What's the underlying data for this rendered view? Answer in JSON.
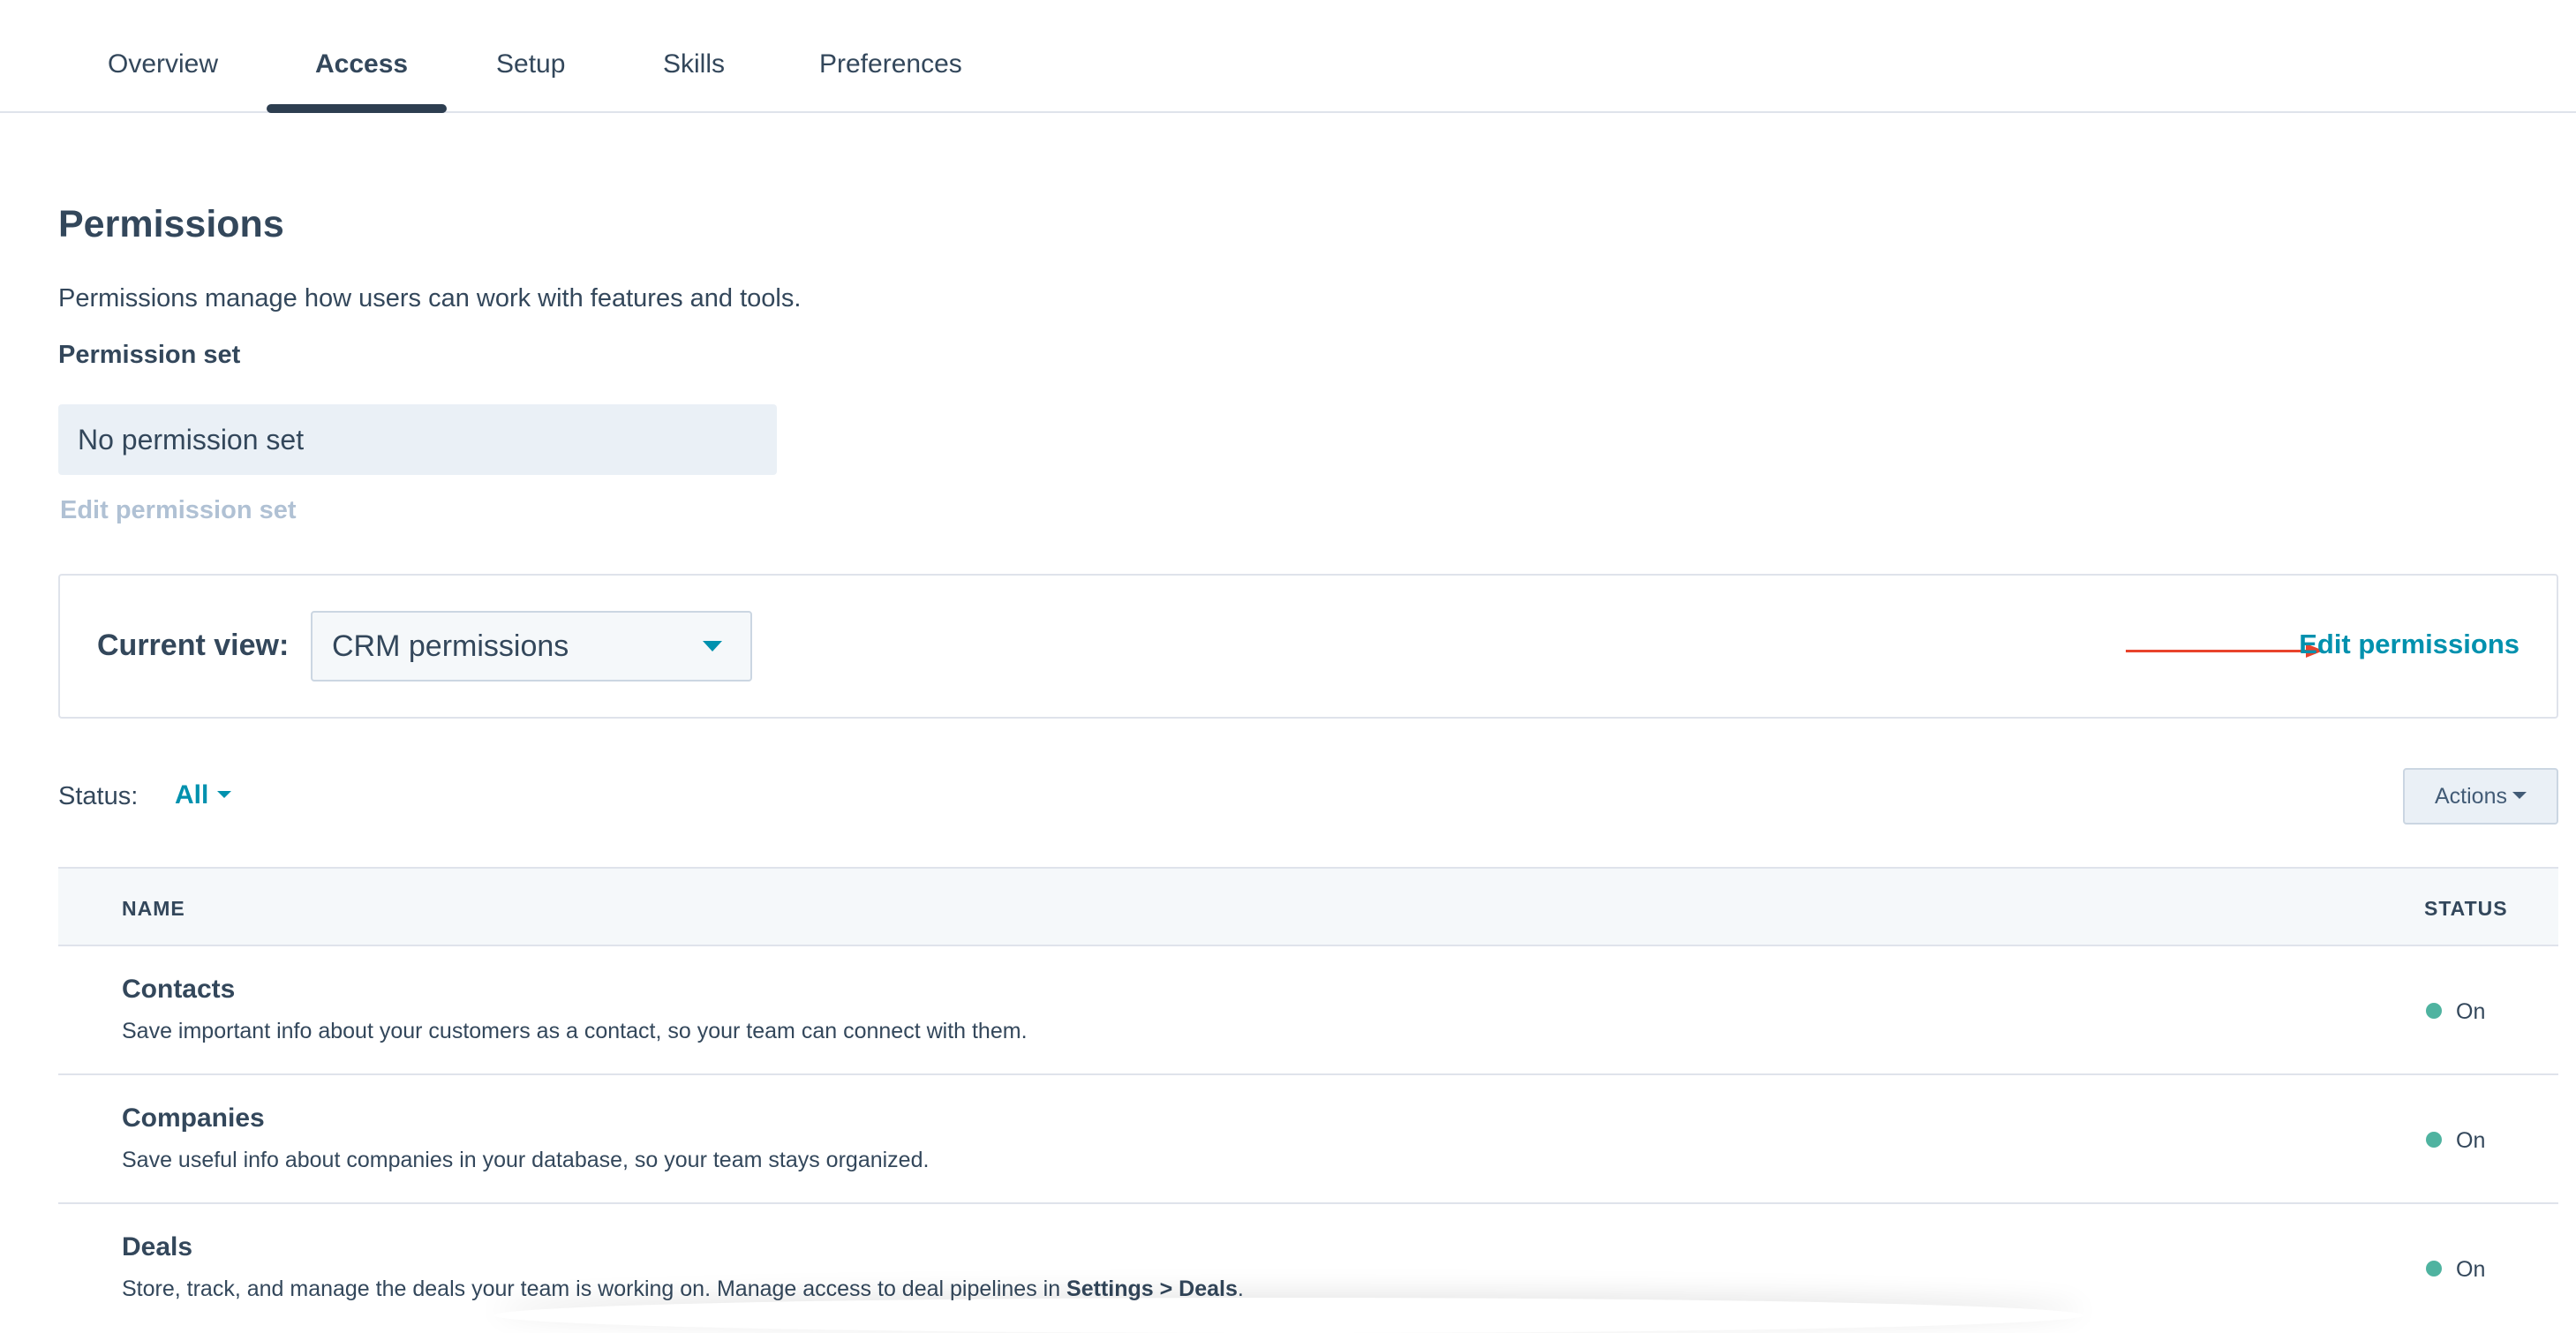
{
  "tabs": [
    {
      "label": "Overview",
      "active": false
    },
    {
      "label": "Access",
      "active": true
    },
    {
      "label": "Setup",
      "active": false
    },
    {
      "label": "Skills",
      "active": false
    },
    {
      "label": "Preferences",
      "active": false
    }
  ],
  "permissions": {
    "title": "Permissions",
    "description": "Permissions manage how users can work with features and tools.",
    "set_label": "Permission set",
    "set_value": "No permission set",
    "edit_set_link": "Edit permission set"
  },
  "view": {
    "label": "Current view:",
    "selected": "CRM permissions",
    "edit_link": "Edit permissions",
    "accent_color": "#0091ae",
    "arrow_color": "#e8432c"
  },
  "filter": {
    "status_label": "Status:",
    "status_value": "All",
    "actions_label": "Actions"
  },
  "table": {
    "columns": {
      "name": "NAME",
      "status": "STATUS"
    },
    "rows": [
      {
        "title": "Contacts",
        "description": "Save important info about your customers as a contact, so your team can connect with them.",
        "status": "On"
      },
      {
        "title": "Companies",
        "description": "Save useful info about companies in your database, so your team stays organized.",
        "status": "On"
      },
      {
        "title": "Deals",
        "description_prefix": "Store, track, and manage the deals your team is working on. Manage access to deal pipelines in ",
        "description_bold": "Settings > Deals",
        "description_suffix": ".",
        "status": "On"
      }
    ],
    "status_on_color": "#4fb3a0"
  }
}
